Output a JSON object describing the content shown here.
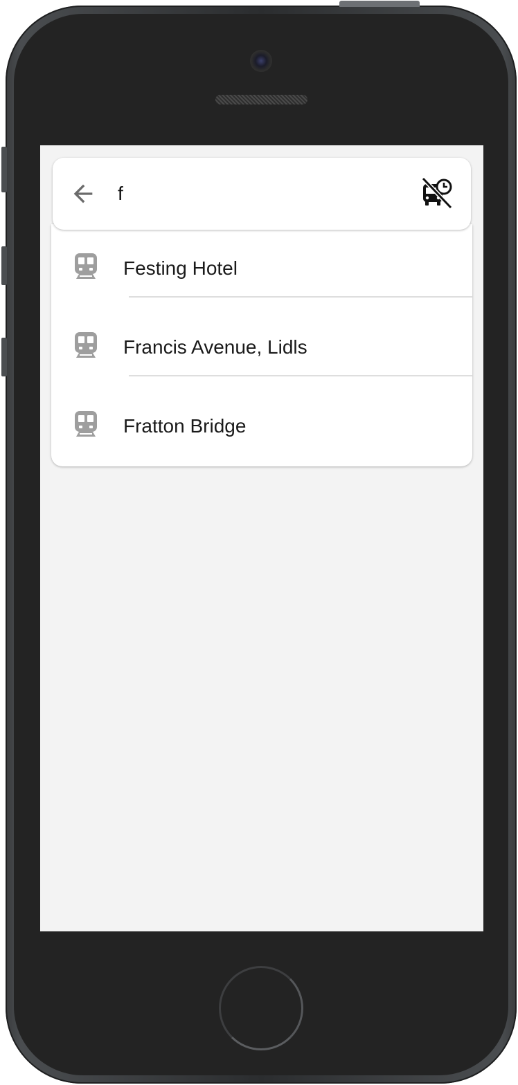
{
  "search": {
    "query": "f",
    "back_icon": "arrow-back-icon",
    "toggle_icon": "bus-schedule-off-icon"
  },
  "results": [
    {
      "icon": "tram-icon",
      "label": "Festing Hotel"
    },
    {
      "icon": "tram-icon",
      "label": "Francis Avenue, Lidls"
    },
    {
      "icon": "tram-icon",
      "label": "Fratton Bridge"
    }
  ],
  "colors": {
    "screen_background": "#f3f3f3",
    "card_background": "#ffffff",
    "icon_grey": "#9e9e9e",
    "text": "#1a1a1a",
    "frame": "#232323"
  }
}
